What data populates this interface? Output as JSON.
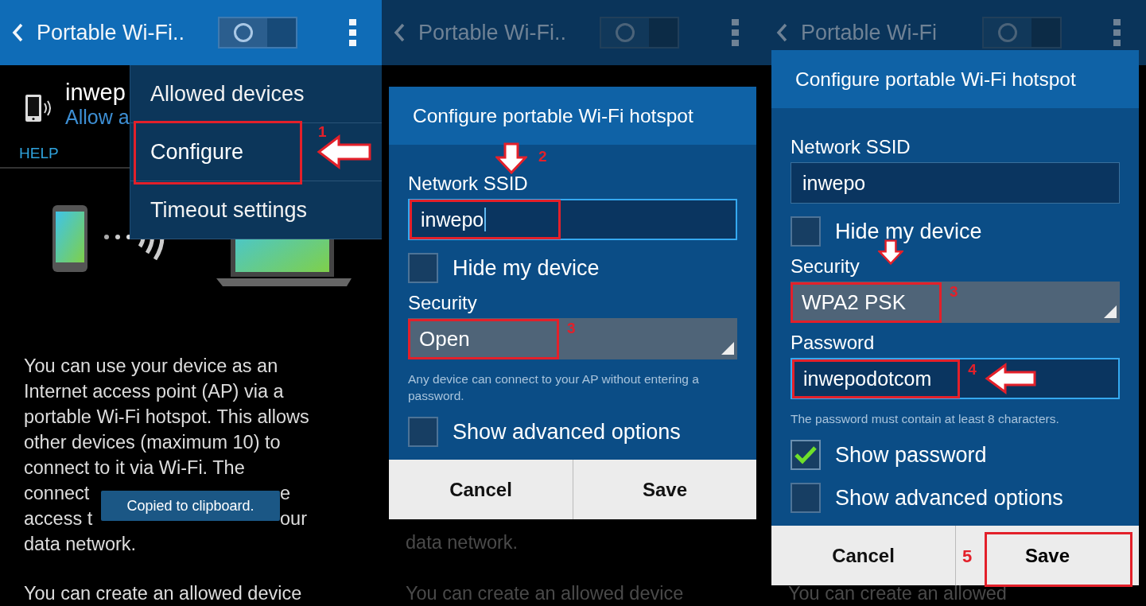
{
  "screens": [
    {
      "kind": "menu",
      "action_bar": {
        "title": "Portable Wi-Fi..",
        "switch_on": false
      },
      "hotspot": {
        "name": "inwep",
        "subtitle": "Allow a"
      },
      "tab": "HELP",
      "description": [
        [
          "You can use your device as an"
        ],
        [
          "Internet access point (AP) via a"
        ],
        [
          "portable Wi-Fi hotspot. This allows"
        ],
        [
          "other devices (maximum 10) to"
        ],
        [
          "connect to it via Wi-Fi. The"
        ],
        [
          "connect",
          "e"
        ],
        [
          "access t",
          "our"
        ],
        [
          "data network."
        ]
      ],
      "description_2": "You can create an allowed device",
      "toast": "Copied to clipboard.",
      "menu": [
        {
          "label": "Allowed devices",
          "highlighted": false
        },
        {
          "label": "Configure",
          "highlighted": true,
          "marker": {
            "number": "1",
            "arrow_left": true
          }
        },
        {
          "label": "Timeout settings",
          "highlighted": false
        }
      ]
    },
    {
      "kind": "dialog",
      "action_bar": {
        "title": "Portable Wi-Fi..",
        "switch_on": false
      },
      "background_text": [
        "data network.",
        "You can create an allowed device"
      ],
      "dialog": {
        "title": "Configure portable Wi-Fi hotspot",
        "items": [
          {
            "kind": "label",
            "text": "Network SSID",
            "marker": {
              "number": "2",
              "arrow_down": true
            }
          },
          {
            "kind": "text_field",
            "value": "inwepo",
            "focused": true,
            "cursor": true,
            "highlighted": true
          },
          {
            "kind": "checkbox",
            "text": "Hide my device",
            "checked": false
          },
          {
            "kind": "label",
            "text": "Security"
          },
          {
            "kind": "dropdown",
            "value": "Open",
            "highlighted": true,
            "marker": {
              "number": "3"
            }
          },
          {
            "kind": "hint",
            "text": "Any device can connect to your AP without entering a password."
          },
          {
            "kind": "checkbox",
            "text": "Show advanced options",
            "checked": false
          }
        ],
        "buttons": [
          {
            "label": "Cancel",
            "highlighted": false
          },
          {
            "label": "Save",
            "highlighted": false
          }
        ]
      }
    },
    {
      "kind": "dialog",
      "action_bar": {
        "title": "Portable Wi-Fi",
        "switch_on": false
      },
      "background_text": [
        "You can create an allowed"
      ],
      "dialog": {
        "title": "Configure portable Wi-Fi hotspot",
        "items": [
          {
            "kind": "label",
            "text": "Network SSID"
          },
          {
            "kind": "text_field",
            "value": "inwepo",
            "focused": false,
            "highlighted": false
          },
          {
            "kind": "checkbox",
            "text": "Hide my device",
            "checked": false
          },
          {
            "kind": "label",
            "text": "Security",
            "marker": {
              "arrow_down": true
            }
          },
          {
            "kind": "dropdown",
            "value": "WPA2 PSK",
            "highlighted": true,
            "marker": {
              "number": "3"
            }
          },
          {
            "kind": "label",
            "text": "Password"
          },
          {
            "kind": "text_field",
            "value": "inwepodotcom",
            "focused": true,
            "highlighted": true,
            "marker": {
              "number": "4",
              "arrow_left": true
            }
          },
          {
            "kind": "hint",
            "text": "The password must contain at least 8 characters."
          },
          {
            "kind": "checkbox",
            "text": "Show password",
            "checked": true
          },
          {
            "kind": "checkbox",
            "text": "Show advanced options",
            "checked": false
          }
        ],
        "buttons": [
          {
            "label": "Cancel",
            "highlighted": false
          },
          {
            "label": "Save",
            "highlighted": true,
            "marker": {
              "number": "5"
            }
          }
        ]
      }
    }
  ]
}
